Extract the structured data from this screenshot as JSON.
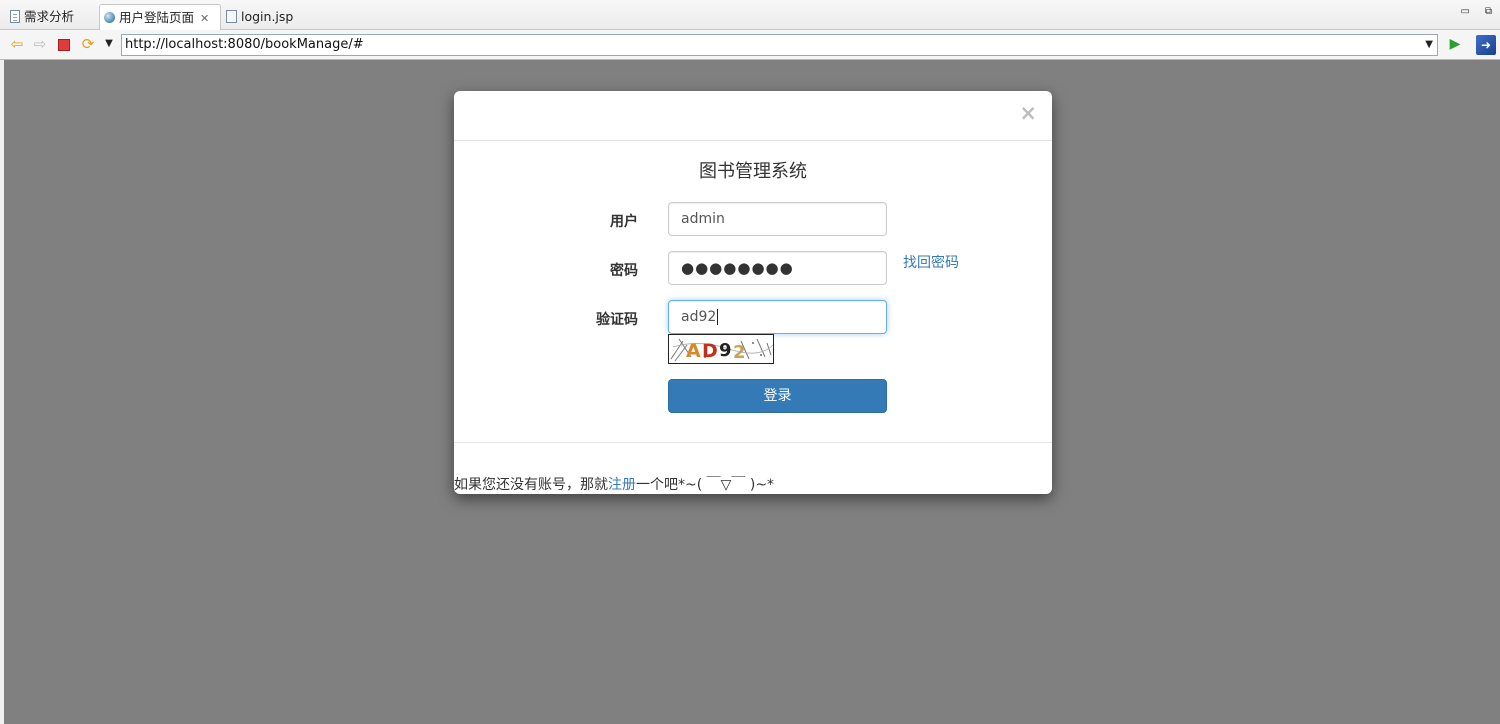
{
  "tabs": [
    {
      "label": "需求分析",
      "icon": "document-icon"
    },
    {
      "label": "用户登陆页面",
      "icon": "globe-icon",
      "active": true
    },
    {
      "label": "login.jsp",
      "icon": "jsp-file-icon"
    }
  ],
  "toolbar": {
    "url": "http://localhost:8080/bookManage/#"
  },
  "modal": {
    "close_glyph": "×",
    "title": "图书管理系统",
    "username_label": "用户",
    "username_value": "admin",
    "password_label": "密码",
    "password_mask": "●●●●●●●●",
    "forgot_link": "找回密码",
    "captcha_label": "验证码",
    "captcha_value": "ad92",
    "captcha_image_text": "AD92",
    "login_button": "登录",
    "footer_prefix": "如果您还没有账号，那就",
    "footer_link": "注册",
    "footer_suffix": "一个吧*~( ￣▽￣ )~*"
  },
  "colors": {
    "primary": "#337ab7",
    "backdrop": "#808080"
  }
}
